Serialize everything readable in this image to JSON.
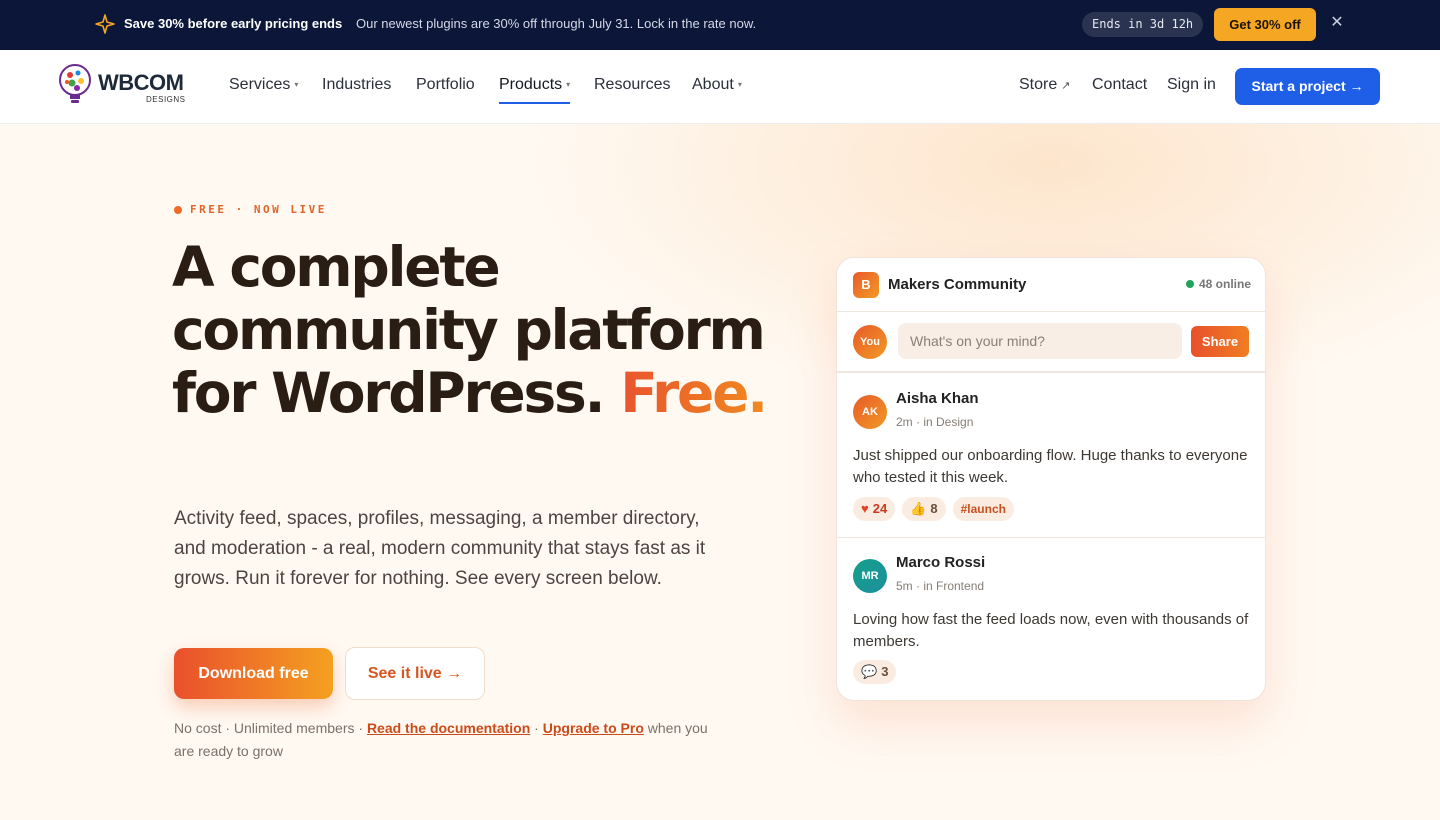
{
  "promo": {
    "headline": "Save 30% before early pricing ends",
    "text": "Our newest plugins are 30% off through July 31. Lock in the rate now.",
    "timer": "Ends in 3d 12h",
    "cta": "Get 30% off",
    "close_icon": "close-icon",
    "star_icon": "sparkle-icon",
    "star_color": "#f5a623"
  },
  "nav": {
    "logo_word": "WBCOM",
    "logo_sub": "DESIGNS",
    "items": [
      {
        "label": "Services",
        "dropdown": true
      },
      {
        "label": "Industries",
        "dropdown": false
      },
      {
        "label": "Portfolio",
        "dropdown": false
      },
      {
        "label": "Products",
        "dropdown": true,
        "active": true
      },
      {
        "label": "Resources",
        "dropdown": false
      },
      {
        "label": "About",
        "dropdown": true
      }
    ],
    "store": "Store",
    "contact": "Contact",
    "signin": "Sign in",
    "start": "Start a project",
    "accent": "#1f5ee6"
  },
  "hero": {
    "eyebrow": "FREE · NOW LIVE",
    "headline_main": "A complete community platform for WordPress.",
    "headline_accent": "Free.",
    "subtext": "Activity feed, spaces, profiles, messaging, a member directory, and moderation - a real, modern community that stays fast as it grows. Run it forever for nothing. See every screen below.",
    "download": "Download free",
    "see_live": "See it live →",
    "fine_1": "No cost · Unlimited members · ",
    "fine_link_docs": "Read the documentation",
    "fine_2": " · ",
    "fine_link_pro": "Upgrade to Pro",
    "fine_3": " when you are ready to grow",
    "accent": "#e8542e"
  },
  "card": {
    "badge": "B",
    "title": "Makers Community",
    "online": "48 online",
    "you": "You",
    "compose_placeholder": "What's on your mind?",
    "share": "Share",
    "posts": [
      {
        "initials": "AK",
        "name": "Aisha Khan",
        "meta": "2m · in Design",
        "body": "Just shipped our onboarding flow. Huge thanks to everyone who tested it this week.",
        "likes": "24",
        "thumbs": "8",
        "tag": "#launch"
      },
      {
        "initials": "MR",
        "name": "Marco Rossi",
        "meta": "5m · in Frontend",
        "body": "Loving how fast the feed loads now, even with thousands of members.",
        "comments": "3"
      }
    ]
  }
}
